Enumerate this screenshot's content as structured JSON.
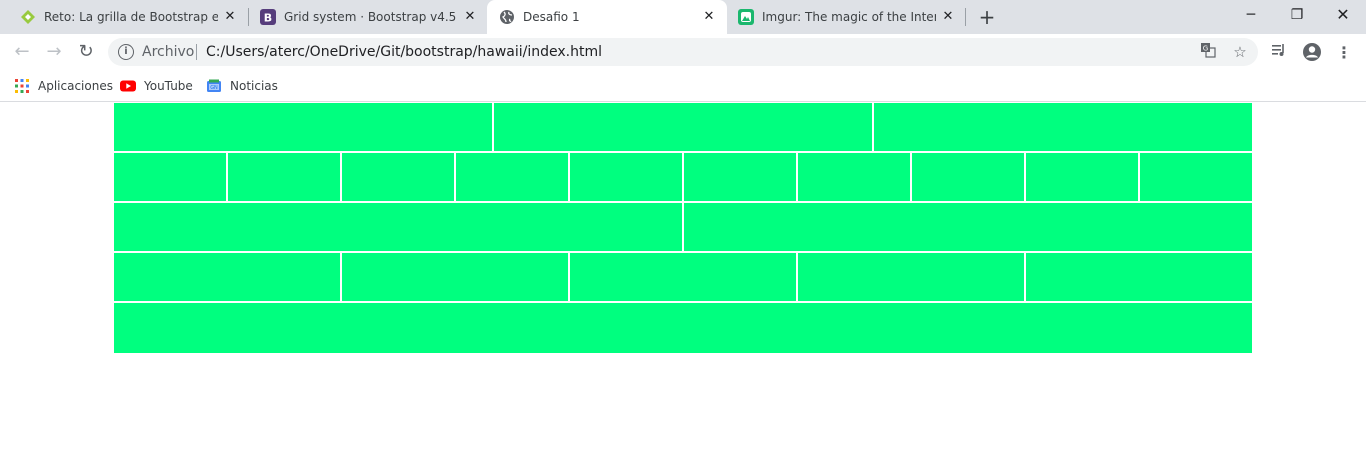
{
  "tabs": [
    {
      "title": "Reto: La grilla de Bootstrap en Cu",
      "icon": "platzi-icon",
      "active": false
    },
    {
      "title": "Grid system · Bootstrap v4.5",
      "icon": "bootstrap-icon",
      "active": false
    },
    {
      "title": "Desafio 1",
      "icon": "globe-icon",
      "active": true
    },
    {
      "title": "Imgur: The magic of the Internet",
      "icon": "imgur-icon",
      "active": false
    }
  ],
  "toolbar": {
    "scheme_label": "Archivo",
    "url": "C:/Users/aterc/OneDrive/Git/bootstrap/hawaii/index.html"
  },
  "bookmarks": [
    {
      "label": "Aplicaciones",
      "icon": "apps-grid-icon"
    },
    {
      "label": "YouTube",
      "icon": "youtube-icon"
    },
    {
      "label": "Noticias",
      "icon": "news-icon"
    }
  ],
  "grid": {
    "color": "#00ff7f",
    "rows": [
      {
        "columns": 3
      },
      {
        "columns": 10
      },
      {
        "columns": 2
      },
      {
        "columns": 5
      },
      {
        "columns": 1
      }
    ]
  }
}
